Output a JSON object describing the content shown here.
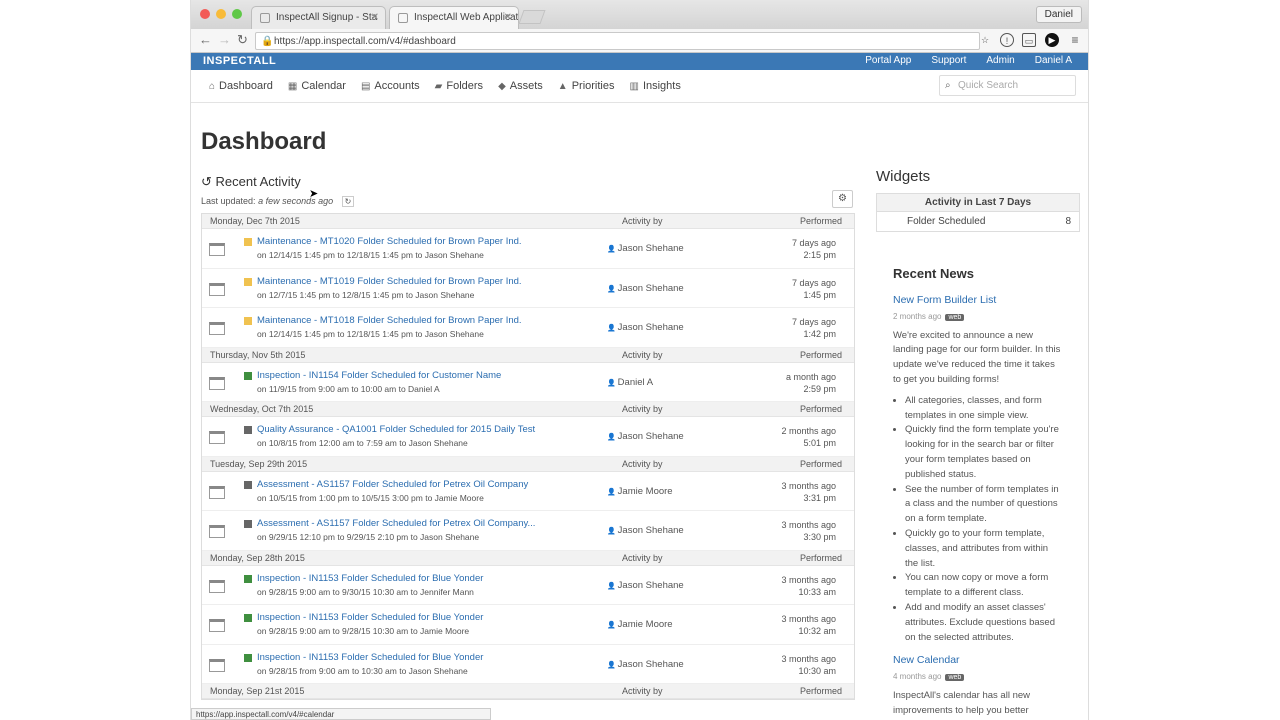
{
  "browser": {
    "tabs": [
      {
        "label": "InspectAll Signup - Sta"
      },
      {
        "label": "InspectAll Web Application"
      }
    ],
    "profile": "Daniel",
    "url": "https://app.inspectall.com/v4/#dashboard",
    "status_url": "https://app.inspectall.com/v4/#calendar"
  },
  "app": {
    "brand": "INSPECTALL",
    "top_links": [
      "Portal App",
      "Support",
      "Admin",
      "Daniel A"
    ]
  },
  "nav": {
    "items": [
      {
        "label": "Dashboard",
        "icon": "home-icon"
      },
      {
        "label": "Calendar",
        "icon": "calendar-icon"
      },
      {
        "label": "Accounts",
        "icon": "accounts-icon"
      },
      {
        "label": "Folders",
        "icon": "folder-icon"
      },
      {
        "label": "Assets",
        "icon": "tag-icon"
      },
      {
        "label": "Priorities",
        "icon": "warning-icon"
      },
      {
        "label": "Insights",
        "icon": "chart-icon"
      }
    ],
    "search_placeholder": "Quick Search"
  },
  "dashboard": {
    "title": "Dashboard",
    "recent_activity": "Recent Activity",
    "last_updated_label": "Last updated:",
    "last_updated_value": "a few seconds ago",
    "groups": [
      {
        "date": "Monday, Dec 7th 2015",
        "activity_by": "Activity by",
        "performed": "Performed",
        "rows": [
          {
            "color": "yellow",
            "title": "Maintenance - MT1020  Folder Scheduled for Brown Paper Ind.",
            "detail": "on 12/14/15 1:45 pm to 12/18/15 1:45 pm  to  Jason Shehane",
            "who": "Jason Shehane",
            "when1": "7 days ago",
            "when2": "2:15 pm"
          },
          {
            "color": "yellow",
            "title": "Maintenance - MT1019  Folder Scheduled for Brown Paper Ind.",
            "detail": "on 12/7/15 1:45 pm to 12/8/15 1:45 pm  to  Jason Shehane",
            "who": "Jason Shehane",
            "when1": "7 days ago",
            "when2": "1:45 pm"
          },
          {
            "color": "yellow",
            "title": "Maintenance - MT1018  Folder Scheduled for Brown Paper Ind.",
            "detail": "on 12/14/15 1:45 pm to 12/18/15 1:45 pm  to  Jason Shehane",
            "who": "Jason Shehane",
            "when1": "7 days ago",
            "when2": "1:42 pm"
          }
        ]
      },
      {
        "date": "Thursday, Nov 5th 2015",
        "activity_by": "Activity by",
        "performed": "Performed",
        "rows": [
          {
            "color": "green",
            "title": "Inspection - IN1154  Folder Scheduled for Customer Name",
            "detail": "on 11/9/15 from 9:00 am to 10:00 am  to  Daniel A",
            "who": "Daniel A",
            "when1": "a month ago",
            "when2": "2:59 pm"
          }
        ]
      },
      {
        "date": "Wednesday, Oct 7th 2015",
        "activity_by": "Activity by",
        "performed": "Performed",
        "rows": [
          {
            "color": "gray",
            "title": "Quality Assurance - QA1001  Folder Scheduled for 2015 Daily Test",
            "detail": "on 10/8/15 from 12:00 am to 7:59 am  to  Jason Shehane",
            "who": "Jason Shehane",
            "when1": "2 months ago",
            "when2": "5:01 pm"
          }
        ]
      },
      {
        "date": "Tuesday, Sep 29th 2015",
        "activity_by": "Activity by",
        "performed": "Performed",
        "rows": [
          {
            "color": "gray",
            "title": "Assessment - AS1157  Folder Scheduled for Petrex Oil Company",
            "detail": "on 10/5/15 from 1:00 pm to 10/5/15 3:00 pm  to  Jamie Moore",
            "who": "Jamie Moore",
            "when1": "3 months ago",
            "when2": "3:31 pm"
          },
          {
            "color": "gray",
            "title": "Assessment - AS1157  Folder Scheduled for Petrex Oil Company...",
            "detail": "on 9/29/15 12:10 pm to 9/29/15 2:10 pm  to  Jason Shehane",
            "who": "Jason Shehane",
            "when1": "3 months ago",
            "when2": "3:30 pm"
          }
        ]
      },
      {
        "date": "Monday, Sep 28th 2015",
        "activity_by": "Activity by",
        "performed": "Performed",
        "rows": [
          {
            "color": "green",
            "title": "Inspection - IN1153  Folder Scheduled for Blue Yonder",
            "detail": "on 9/28/15 9:00 am to 9/30/15 10:30 am  to  Jennifer Mann",
            "who": "Jason Shehane",
            "when1": "3 months ago",
            "when2": "10:33 am"
          },
          {
            "color": "green",
            "title": "Inspection - IN1153  Folder Scheduled for Blue Yonder",
            "detail": "on 9/28/15 9:00 am to 9/28/15 10:30 am  to  Jamie Moore",
            "who": "Jamie Moore",
            "when1": "3 months ago",
            "when2": "10:32 am"
          },
          {
            "color": "green",
            "title": "Inspection - IN1153  Folder Scheduled for Blue Yonder",
            "detail": "on 9/28/15 from 9:00 am to 10:30 am  to  Jason Shehane",
            "who": "Jason Shehane",
            "when1": "3 months ago",
            "when2": "10:30 am"
          }
        ]
      },
      {
        "date": "Monday, Sep 21st 2015",
        "activity_by": "Activity by",
        "performed": "Performed",
        "rows": []
      }
    ]
  },
  "widgets": {
    "title": "Widgets",
    "card_header": "Activity in Last 7 Days",
    "line_label": "Folder Scheduled",
    "line_count": "8"
  },
  "news": {
    "title": "Recent News",
    "items": [
      {
        "headline": "New Form Builder List",
        "meta": "2 months ago",
        "badge": "web",
        "intro": "We're excited to announce a new landing page for our form builder. In this update we've reduced the time it takes to get you building forms!",
        "bullets": [
          "All categories, classes, and form templates in one simple view.",
          "Quickly find the form template you're looking for in the search bar or filter your form templates based on published status.",
          "See the number of form templates in a class and the number of questions on a form template.",
          "Quickly go to your form template, classes, and attributes from within the list.",
          "You can now copy or move a form template to a different class.",
          "Add and modify an asset classes' attributes. Exclude questions based on the selected attributes."
        ]
      },
      {
        "headline": "New Calendar",
        "meta": "4 months ago",
        "badge": "web",
        "intro": "InspectAll's calendar has all new improvements to help you better manage your folder's workflow."
      }
    ]
  }
}
